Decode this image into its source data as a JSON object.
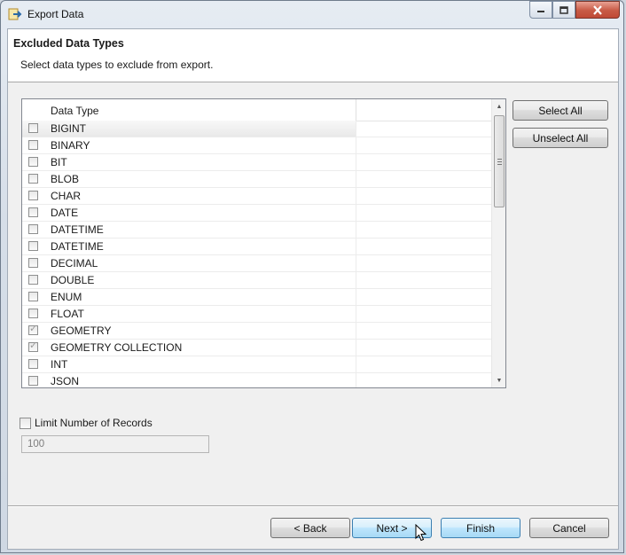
{
  "window": {
    "title": "Export Data"
  },
  "header": {
    "title": "Excluded Data Types",
    "description": "Select data types to exclude from export."
  },
  "table": {
    "column_header": "Data Type",
    "rows": [
      {
        "label": "BIGINT",
        "checked": false
      },
      {
        "label": "BINARY",
        "checked": false
      },
      {
        "label": "BIT",
        "checked": false
      },
      {
        "label": "BLOB",
        "checked": false
      },
      {
        "label": "CHAR",
        "checked": false
      },
      {
        "label": "DATE",
        "checked": false
      },
      {
        "label": "DATETIME",
        "checked": false
      },
      {
        "label": "DATETIME",
        "checked": false
      },
      {
        "label": "DECIMAL",
        "checked": false
      },
      {
        "label": "DOUBLE",
        "checked": false
      },
      {
        "label": "ENUM",
        "checked": false
      },
      {
        "label": "FLOAT",
        "checked": false
      },
      {
        "label": "GEOMETRY",
        "checked": true
      },
      {
        "label": "GEOMETRY COLLECTION",
        "checked": true
      },
      {
        "label": "INT",
        "checked": false
      },
      {
        "label": "JSON",
        "checked": false
      }
    ]
  },
  "side_buttons": {
    "select_all": "Select All",
    "unselect_all": "Unselect All"
  },
  "limit": {
    "label": "Limit Number of Records",
    "checked": false,
    "value": "100"
  },
  "footer": {
    "back": "< Back",
    "next": "Next >",
    "finish": "Finish",
    "cancel": "Cancel"
  },
  "colors": {
    "accent": "#3c7fb1",
    "close_button": "#c85a45"
  },
  "icons": {
    "app": "export-data-icon",
    "minimize": "minimize-icon",
    "maximize": "maximize-icon",
    "close": "close-icon",
    "scroll_up": "scroll-up-arrow-icon",
    "scroll_down": "scroll-down-arrow-icon",
    "cursor": "mouse-pointer-icon"
  }
}
